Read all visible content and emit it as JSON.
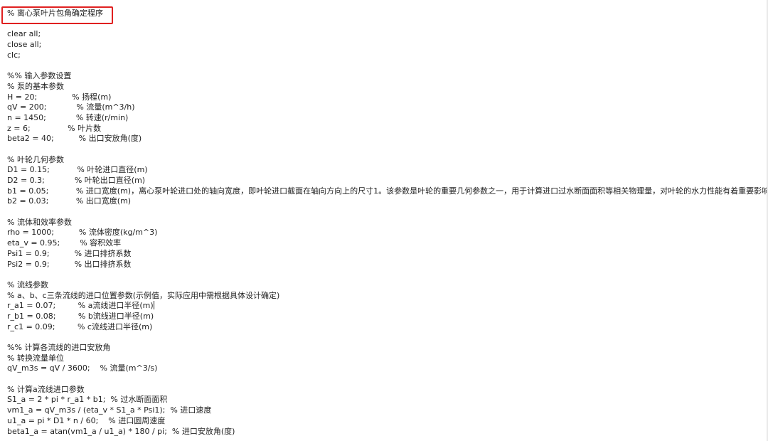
{
  "editor": {
    "lines": [
      "% 离心泵叶片包角确定程序",
      "",
      "clear all;",
      "close all;",
      "clc;",
      "",
      "%% 输入参数设置",
      "% 泵的基本参数",
      "H = 20;              % 扬程(m)",
      "qV = 200;            % 流量(m^3/h)",
      "n = 1450;            % 转速(r/min)",
      "z = 6;               % 叶片数",
      "beta2 = 40;          % 出口安放角(度)",
      "",
      "% 叶轮几何参数",
      "D1 = 0.15;           % 叶轮进口直径(m)",
      "D2 = 0.3;            % 叶轮出口直径(m)",
      "b1 = 0.05;           % 进口宽度(m)，离心泵叶轮进口处的轴向宽度，即叶轮进口截面在轴向方向上的尺寸1。该参数是叶轮的重要几何参数之一，用于计算进口过水断面面积等相关物理量，对叶轮的水力性能有着重要影响",
      "b2 = 0.03;           % 出口宽度(m)",
      "",
      "% 流体和效率参数",
      "rho = 1000;          % 流体密度(kg/m^3)",
      "eta_v = 0.95;        % 容积效率",
      "Psi1 = 0.9;          % 进口排挤系数",
      "Psi2 = 0.9;          % 出口排挤系数",
      "",
      "% 流线参数",
      "% a、b、c三条流线的进口位置参数(示例值，实际应用中需根据具体设计确定)",
      "r_a1 = 0.07;         % a流线进口半径(m)",
      "r_b1 = 0.08;         % b流线进口半径(m)",
      "r_c1 = 0.09;         % c流线进口半径(m)",
      "",
      "%% 计算各流线的进口安放角",
      "% 转换流量单位",
      "qV_m3s = qV / 3600;    % 流量(m^3/s)",
      "",
      "% 计算a流线进口参数",
      "S1_a = 2 * pi * r_a1 * b1;  % 过水断面面积",
      "vm1_a = qV_m3s / (eta_v * S1_a * Psi1);  % 进口速度",
      "u1_a = pi * D1 * n / 60;    % 进口圆周速度",
      "beta1_a = atan(vm1_a / u1_a) * 180 / pi;  % 进口安放角(度)"
    ]
  }
}
